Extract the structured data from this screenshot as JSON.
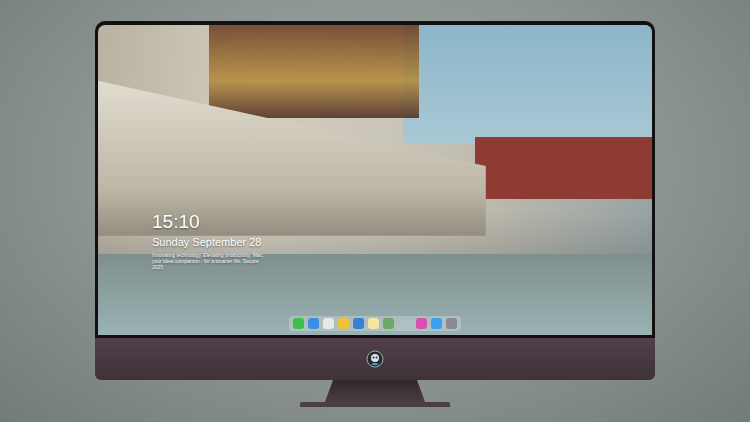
{
  "lock_screen": {
    "time": "15:10",
    "date": "Sunday September 28",
    "tagline": "Innovating technology, Elevating productivity. Mac, your ideal companion - for a smarter life. Secure 2025"
  },
  "dock": {
    "apps": [
      {
        "color": "#3fbf4a"
      },
      {
        "color": "#3a8ee6"
      },
      {
        "color": "#e8e8e8"
      },
      {
        "color": "#f0c23a"
      },
      {
        "color": "#3a7fd6"
      },
      {
        "color": "#f3e7a0"
      },
      {
        "color": "#6aa86a"
      },
      {
        "color": "#d94fb0"
      },
      {
        "color": "#3aa0f0"
      },
      {
        "color": "#8a8a90"
      }
    ]
  }
}
